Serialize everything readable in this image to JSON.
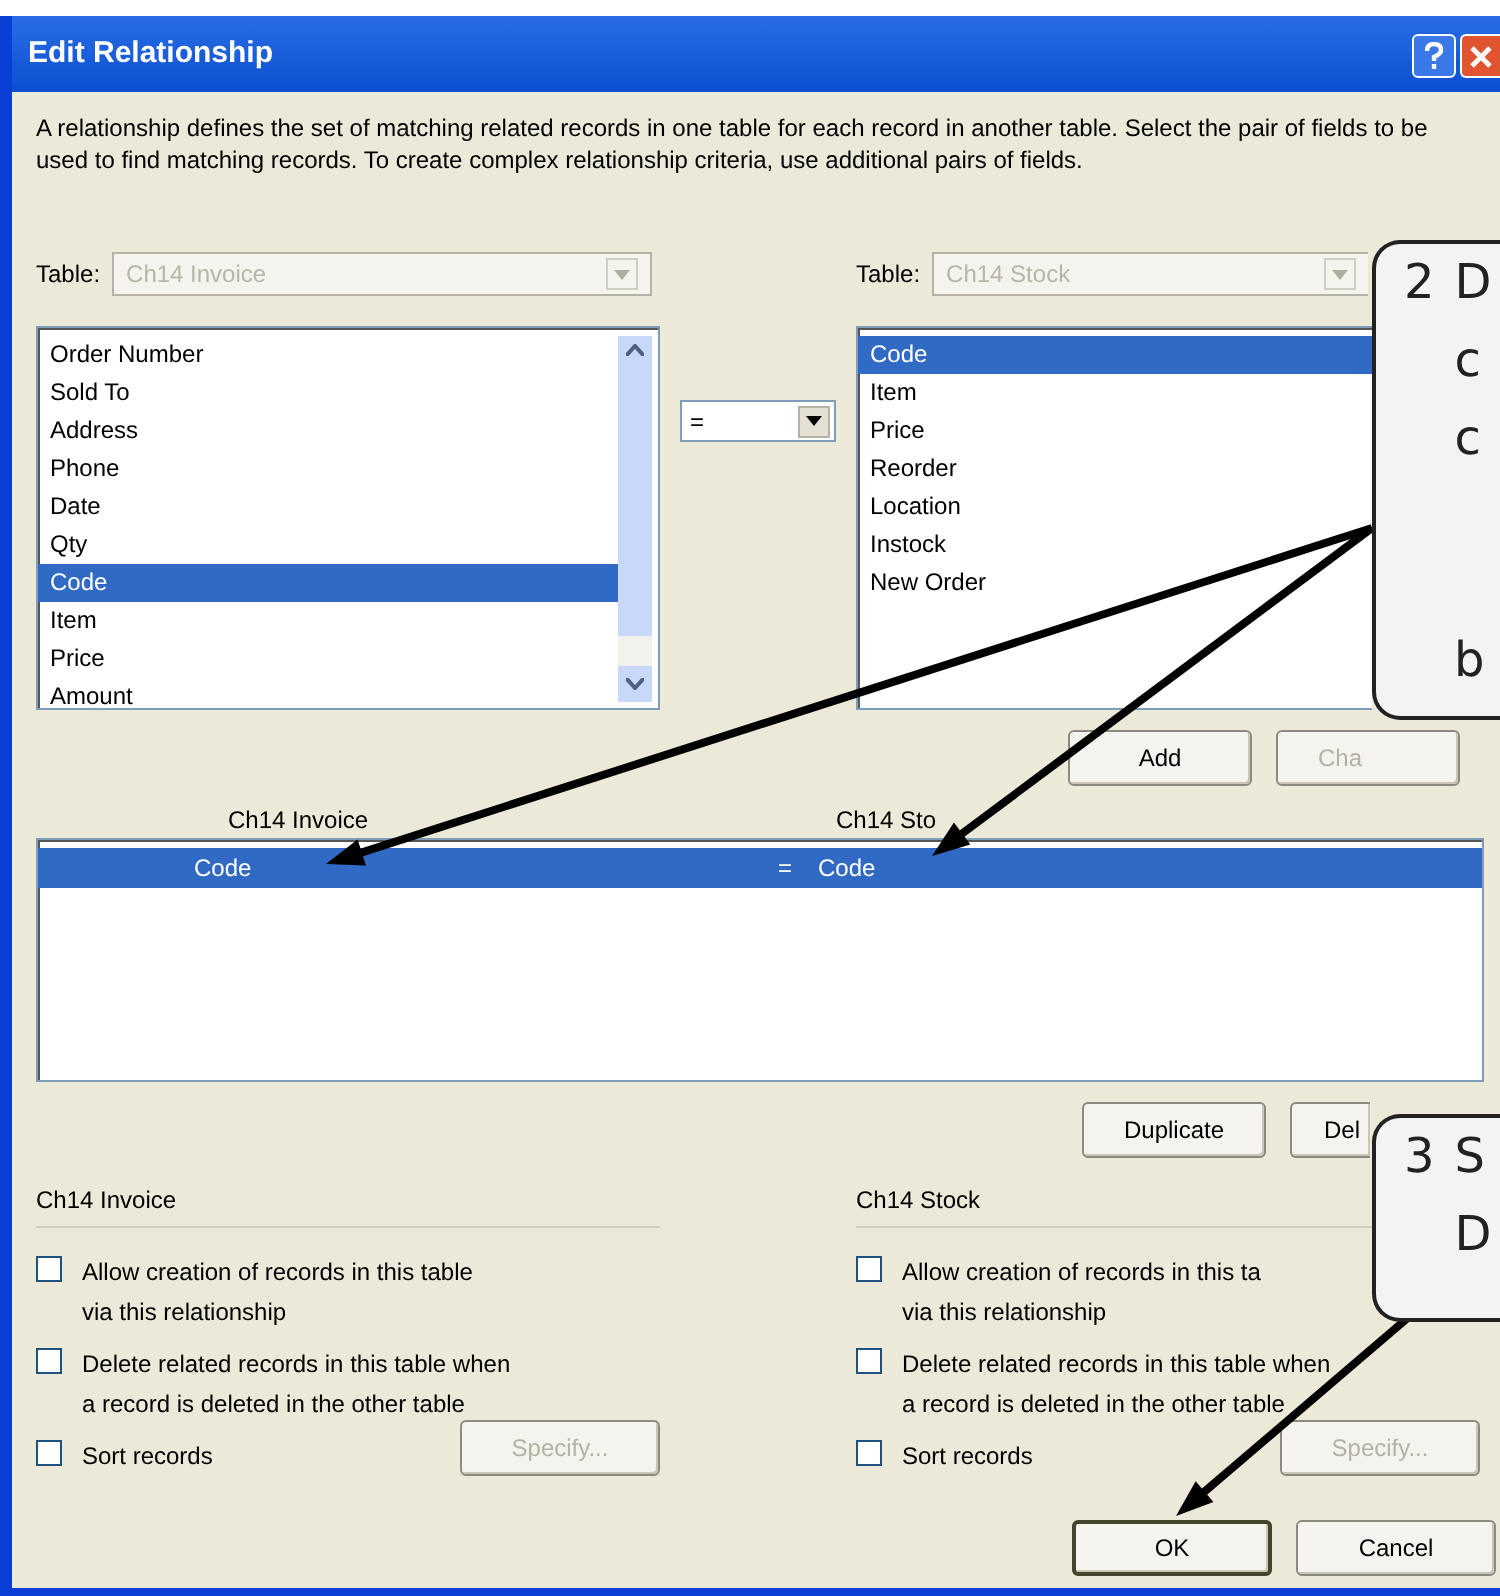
{
  "window": {
    "title": "Edit Relationship"
  },
  "description": "A relationship defines the set of matching related records in one table for each record in another table. Select the pair of fields to be used to find matching records. To create complex relationship criteria, use additional pairs of fields.",
  "tables": [
    {
      "label": "Table:",
      "value": "Ch14 Invoice",
      "disabled": true,
      "fields": [
        {
          "name": "Order Number",
          "selected": false
        },
        {
          "name": "Sold To",
          "selected": false
        },
        {
          "name": "Address",
          "selected": false
        },
        {
          "name": "Phone",
          "selected": false
        },
        {
          "name": "Date",
          "selected": false
        },
        {
          "name": "Qty",
          "selected": false
        },
        {
          "name": "Code",
          "selected": true
        },
        {
          "name": "Item",
          "selected": false
        },
        {
          "name": "Price",
          "selected": false
        },
        {
          "name": "Amount",
          "selected": false
        }
      ],
      "scrollbar": true
    },
    {
      "label": "Table:",
      "value": "Ch14 Stock",
      "disabled": true,
      "fields": [
        {
          "name": "Code",
          "selected": true
        },
        {
          "name": "Item",
          "selected": false
        },
        {
          "name": "Price",
          "selected": false
        },
        {
          "name": "Reorder",
          "selected": false
        },
        {
          "name": "Location",
          "selected": false
        },
        {
          "name": "Instock",
          "selected": false
        },
        {
          "name": "New Order",
          "selected": false
        }
      ],
      "scrollbar": false
    }
  ],
  "operator": "=",
  "list_buttons": [
    {
      "label": "Add",
      "disabled": false
    },
    {
      "label": "Cha",
      "disabled": true
    }
  ],
  "grid": {
    "columns": [
      "Ch14 Invoice",
      "Ch14 Sto"
    ],
    "rows": [
      {
        "left": "Code",
        "operator": "=",
        "right": "Code",
        "selected": true
      }
    ]
  },
  "grid_buttons": [
    {
      "label": "Duplicate",
      "disabled": false
    },
    {
      "label": "Del",
      "disabled": false
    }
  ],
  "options": [
    {
      "title": "Ch14 Invoice",
      "checkboxes": [
        {
          "label": "Allow creation of records in this table\nvia this relationship",
          "checked": false
        },
        {
          "label": "Delete related records in this table when\na record is deleted in the other table",
          "checked": false
        },
        {
          "label": "Sort records",
          "checked": false
        }
      ],
      "specify": {
        "label": "Specify...",
        "disabled": true
      }
    },
    {
      "title": "Ch14 Stock",
      "checkboxes": [
        {
          "label": "Allow creation of records in this ta\nvia this relationship",
          "checked": false
        },
        {
          "label": "Delete related records in this table when\na record is deleted in the other table",
          "checked": false
        },
        {
          "label": "Sort records",
          "checked": false
        }
      ],
      "specify": {
        "label": "Specify...",
        "disabled": true
      }
    }
  ],
  "dialog_buttons": [
    {
      "label": "OK",
      "default": true
    },
    {
      "label": "Cancel",
      "default": false
    }
  ],
  "callouts": [
    {
      "number": "2",
      "lines": [
        "D",
        "c",
        "c"
      ],
      "tail_lines": [
        "b"
      ]
    },
    {
      "number": "3",
      "lines": [
        "S",
        "D"
      ]
    }
  ]
}
